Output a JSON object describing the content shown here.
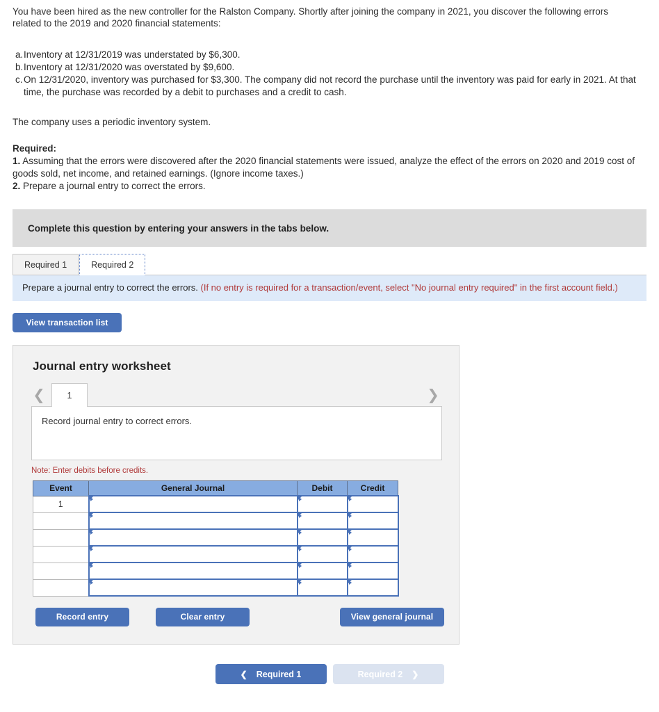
{
  "intro": {
    "paragraph": "You have been hired as the new controller for the Ralston Company. Shortly after joining the company in 2021, you discover the following errors related to the 2019 and 2020 financial statements:"
  },
  "errors": [
    {
      "label": "a.",
      "text": "Inventory at 12/31/2019 was understated by $6,300."
    },
    {
      "label": "b.",
      "text": "Inventory at 12/31/2020 was overstated by $9,600."
    },
    {
      "label": "c.",
      "text": "On 12/31/2020, inventory was purchased for $3,300. The company did not record the purchase until the inventory was paid for early in 2021. At that time, the purchase was recorded by a debit to purchases and a credit to cash."
    }
  ],
  "periodic_note": "The company uses a periodic inventory system.",
  "required": {
    "heading": "Required:",
    "items": [
      {
        "num": "1.",
        "text": " Assuming that the errors were discovered after the 2020 financial statements were issued, analyze the effect of the errors on 2020 and 2019 cost of goods sold, net income, and retained earnings. (Ignore income taxes.)"
      },
      {
        "num": "2.",
        "text": " Prepare a journal entry to correct the errors."
      }
    ]
  },
  "banner": {
    "text": "Complete this question by entering your answers in the tabs below."
  },
  "tabs": [
    {
      "label": "Required 1",
      "active": false
    },
    {
      "label": "Required 2",
      "active": true
    }
  ],
  "info_bar": {
    "main": "Prepare a journal entry to correct the errors. ",
    "hint": "(If no entry is required for a transaction/event, select \"No journal entry required\" in the first account field.)"
  },
  "view_transaction_list_label": "View transaction list",
  "worksheet": {
    "title": "Journal entry worksheet",
    "pager": {
      "prev_icon": "chevron-left-icon",
      "next_icon": "chevron-right-icon",
      "current_page": "1"
    },
    "description": "Record journal entry to correct errors.",
    "note": "Note: Enter debits before credits.",
    "table": {
      "columns": [
        "Event",
        "General Journal",
        "Debit",
        "Credit"
      ],
      "rows": [
        {
          "event": "1",
          "general_journal": "",
          "debit": "",
          "credit": ""
        },
        {
          "event": "",
          "general_journal": "",
          "debit": "",
          "credit": ""
        },
        {
          "event": "",
          "general_journal": "",
          "debit": "",
          "credit": ""
        },
        {
          "event": "",
          "general_journal": "",
          "debit": "",
          "credit": ""
        },
        {
          "event": "",
          "general_journal": "",
          "debit": "",
          "credit": ""
        },
        {
          "event": "",
          "general_journal": "",
          "debit": "",
          "credit": ""
        }
      ]
    },
    "actions": {
      "record": "Record entry",
      "clear": "Clear entry",
      "view_general_journal": "View general journal"
    }
  },
  "bottom_nav": {
    "prev": {
      "label": "Required 1",
      "icon": "chevron-left-icon"
    },
    "next": {
      "label": "Required 2",
      "icon": "chevron-right-icon"
    }
  },
  "colors": {
    "accent_blue": "#4a72b8",
    "table_header_blue": "#87ace0",
    "info_bar_blue": "#deeaf9",
    "banner_gray": "#dcdcdc",
    "note_red": "#b03a3a",
    "disabled_nav": "#dbe3f0"
  }
}
